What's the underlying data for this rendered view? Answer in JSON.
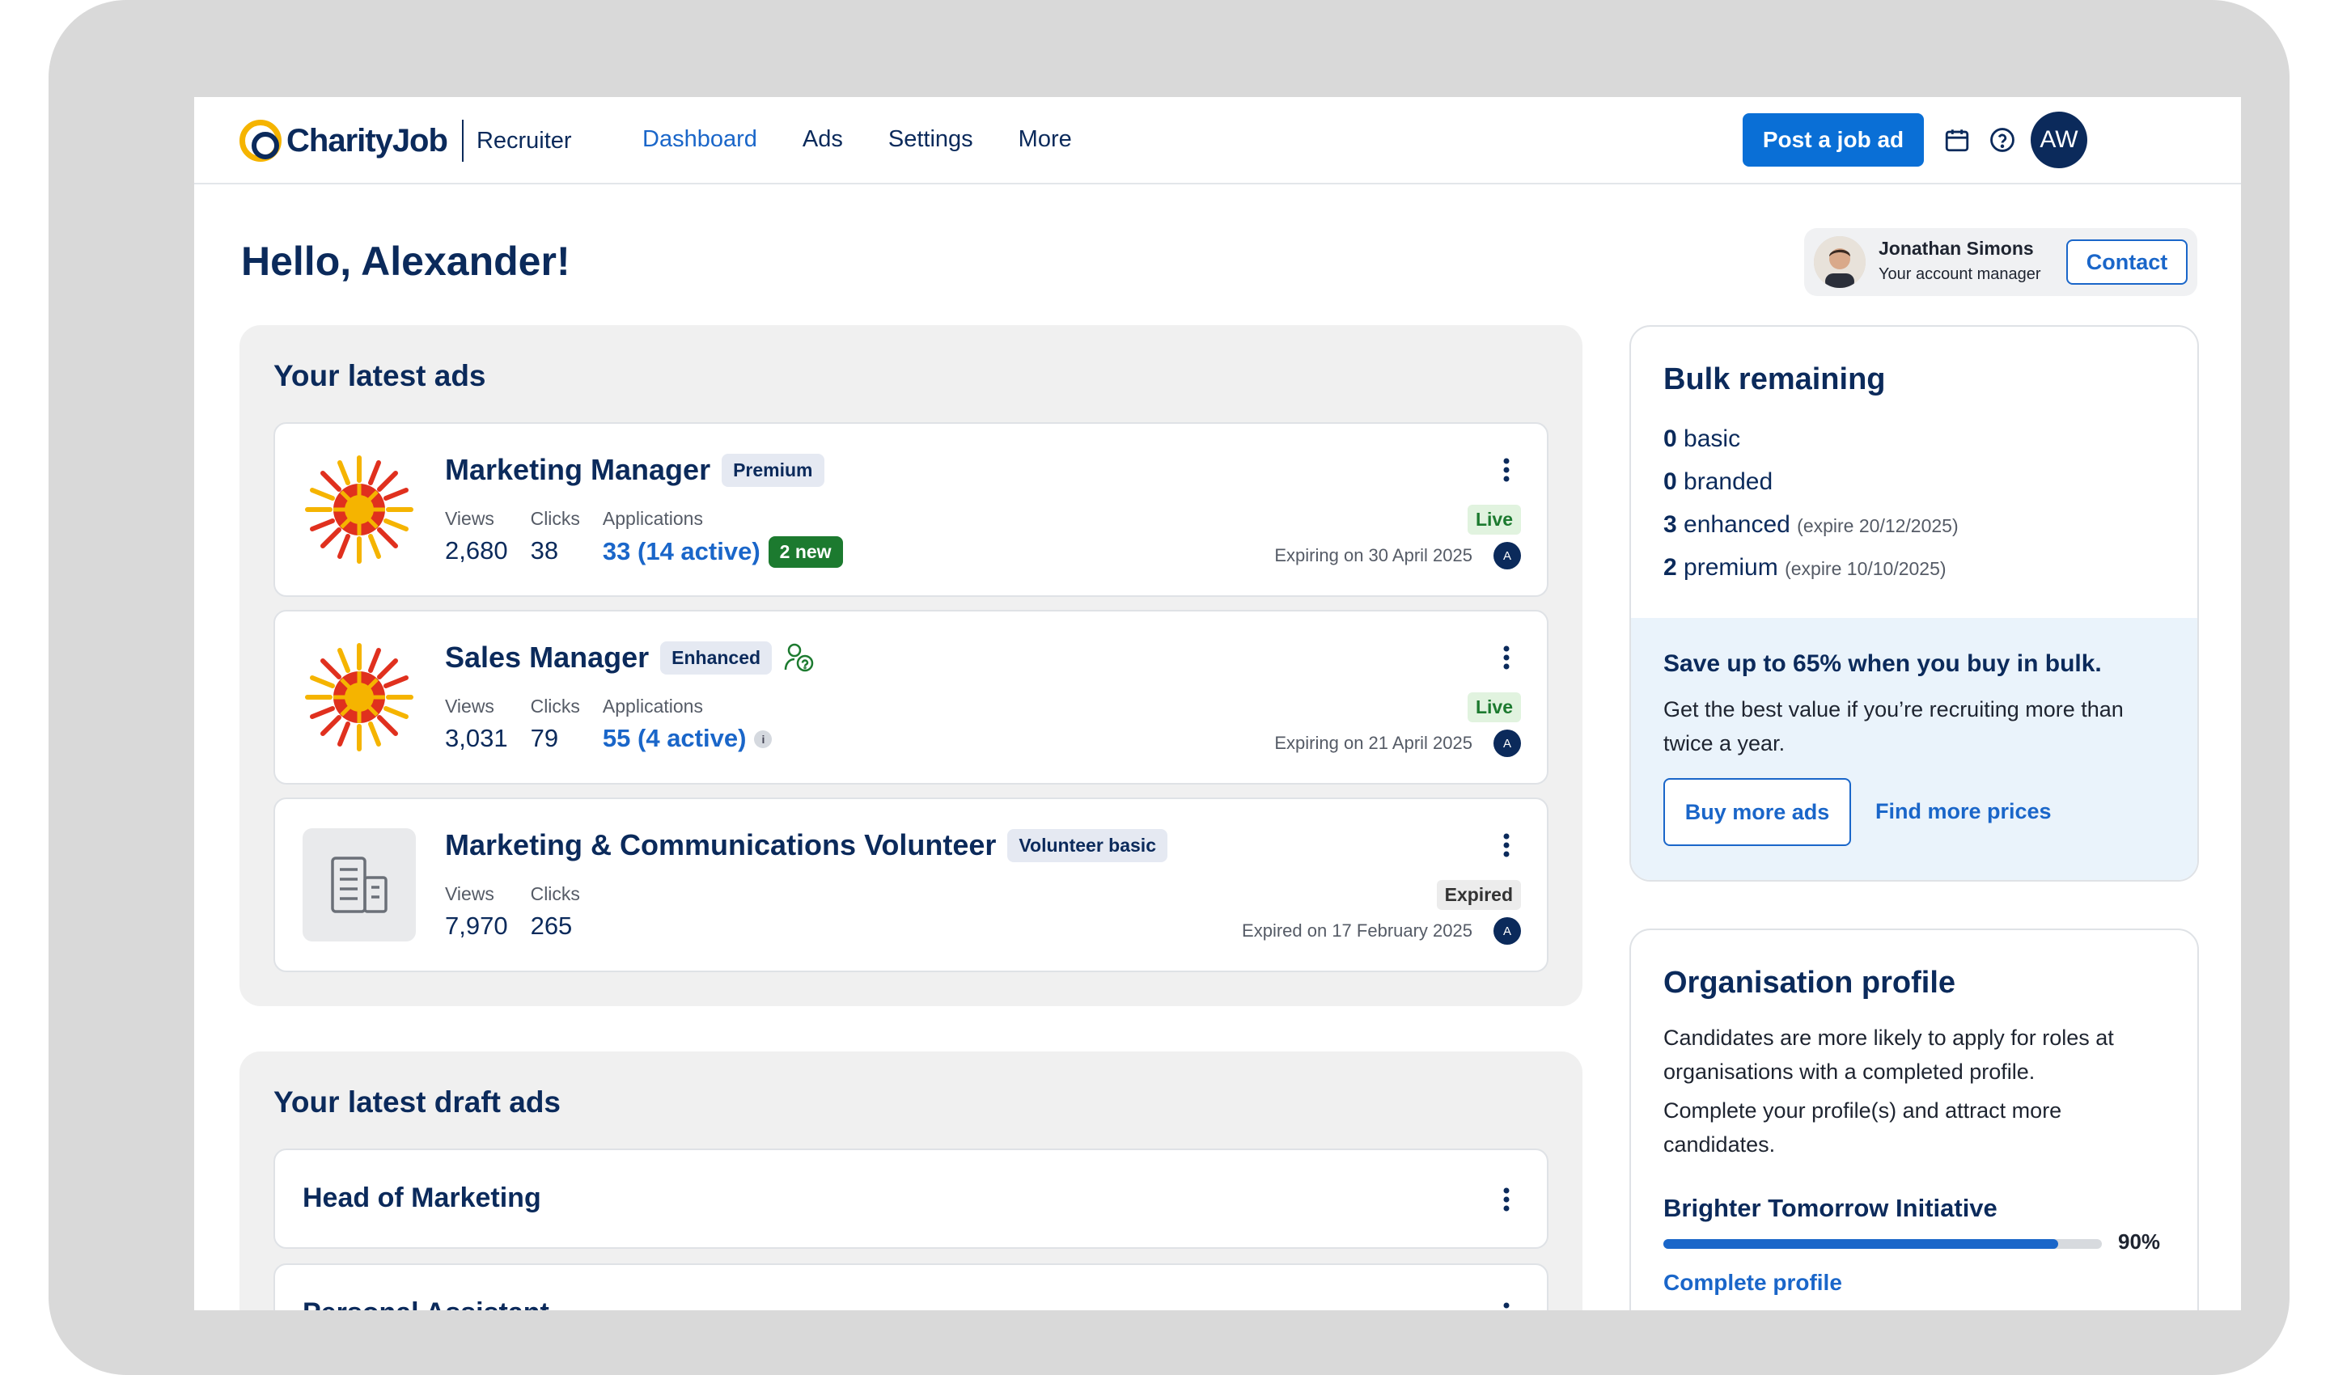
{
  "nav": {
    "brand": "CharityJob",
    "sub": "Recruiter",
    "links": [
      "Dashboard",
      "Ads",
      "Settings",
      "More"
    ],
    "post_label": "Post a job ad",
    "avatar": "AW",
    "calendar_icon": "calendar-icon",
    "help_icon": "help-icon"
  },
  "greeting": "Hello, Alexander!",
  "manager": {
    "name": "Jonathan Simons",
    "role": "Your account manager",
    "contact_label": "Contact"
  },
  "latest_ads": {
    "title": "Your latest ads",
    "labels": {
      "views": "Views",
      "clicks": "Clicks",
      "applications": "Applications"
    },
    "items": [
      {
        "title": "Marketing Manager",
        "tag": "Premium",
        "views": "2,680",
        "clicks": "38",
        "applications": "33 (14 active)",
        "new_badge": "2 new",
        "status": "Live",
        "expiry": "Expiring on 30 April 2025",
        "owner": "A"
      },
      {
        "title": "Sales Manager",
        "tag": "Enhanced",
        "views": "3,031",
        "clicks": "79",
        "applications": "55 (4 active)",
        "info": "i",
        "status": "Live",
        "expiry": "Expiring on 21 April 2025",
        "owner": "A"
      },
      {
        "title": "Marketing & Communications Volunteer",
        "tag": "Volunteer basic",
        "views": "7,970",
        "clicks": "265",
        "status": "Expired",
        "expiry": "Expired on 17 February 2025",
        "owner": "A"
      }
    ]
  },
  "draft_ads": {
    "title": "Your latest draft ads",
    "items": [
      "Head of Marketing",
      "Personal Assistant"
    ]
  },
  "bulk": {
    "title": "Bulk remaining",
    "rows": [
      {
        "count": "0",
        "type": "basic",
        "expire": ""
      },
      {
        "count": "0",
        "type": "branded",
        "expire": ""
      },
      {
        "count": "3",
        "type": "enhanced",
        "expire": "(expire 20/12/2025)"
      },
      {
        "count": "2",
        "type": "premium",
        "expire": "(expire 10/10/2025)"
      }
    ],
    "promo_title": "Save up to 65% when you buy in bulk.",
    "promo_text": "Get the best value if you’re recruiting more than twice a year.",
    "buy_label": "Buy more ads",
    "find_label": "Find more prices"
  },
  "org_profile": {
    "title": "Organisation profile",
    "text1": "Candidates are more likely to apply for roles at organisations with a completed profile.",
    "text2": "Complete your profile(s) and attract more candidates.",
    "org_name": "Brighter Tomorrow Initiative",
    "progress": 0.9,
    "progress_label": "90%",
    "complete_label": "Complete profile"
  },
  "colors": {
    "navy": "#0b2a5b",
    "blue": "#1a66c9",
    "button_blue": "#0a6fd6",
    "green": "#1c7a2f",
    "promo_bg": "#eaf3fb"
  }
}
